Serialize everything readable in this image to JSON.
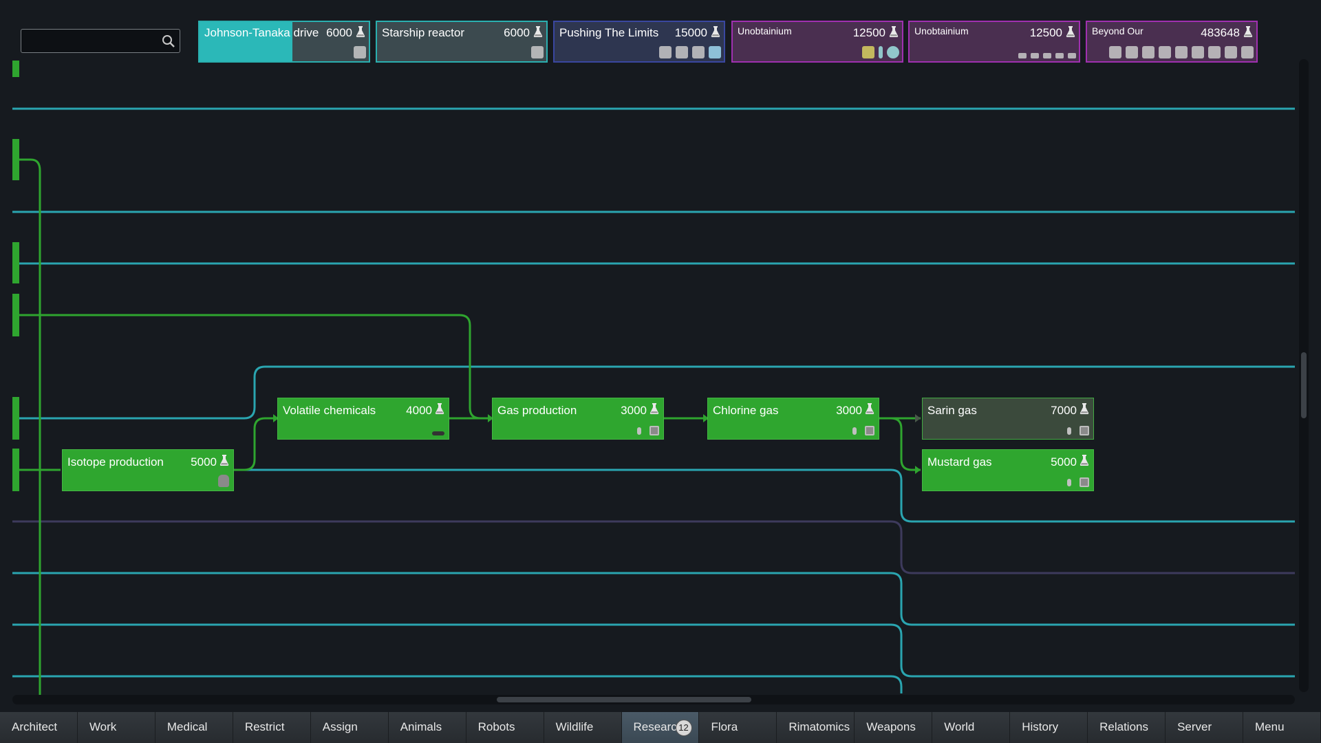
{
  "search": {
    "placeholder": "",
    "value": ""
  },
  "queue": [
    {
      "label": "Johnson-Tanaka drive",
      "cost": "6000",
      "progress": 0.55,
      "bg": "#3c4a4f",
      "fill": "#2bb8b8",
      "border": "#2ab0b0",
      "label_size": "normal",
      "unlocks": [
        "engine-icon"
      ]
    },
    {
      "label": "Starship reactor",
      "cost": "6000",
      "progress": 0,
      "bg": "#3c4a4f",
      "fill": "#2bb8b8",
      "border": "#2ab0b0",
      "label_size": "normal",
      "unlocks": [
        "reactor-icon"
      ]
    },
    {
      "label": "Pushing The Limits",
      "cost": "15000",
      "progress": 0,
      "bg": "#2e3650",
      "fill": "#3a4480",
      "border": "#3a47a0",
      "label_size": "normal",
      "unlocks": [
        "module-icon",
        "pillar-icon",
        "module-icon",
        "core-icon"
      ]
    },
    {
      "label": "Unobtainium",
      "cost": "12500",
      "progress": 0,
      "bg": "#4a2f50",
      "fill": "#7d3a86",
      "border": "#a030b0",
      "label_size": "small",
      "unlocks": [
        "hourglass-icon",
        "rod-icon",
        "orb-icon"
      ]
    },
    {
      "label": "Unobtainium",
      "cost": "12500",
      "progress": 0,
      "bg": "#4a2f50",
      "fill": "#7d3a86",
      "border": "#a030b0",
      "label_size": "small",
      "unlocks": [
        "rifle-icon",
        "rifle-icon",
        "pistol-icon",
        "ammo-icon",
        "ammo-icon"
      ]
    },
    {
      "label": "Beyond Our",
      "cost": "483648",
      "progress": 0,
      "bg": "#4a2f50",
      "fill": "#7d3a86",
      "border": "#a030b0",
      "label_size": "small",
      "unlocks": [
        "chain-icon",
        "plate-icon",
        "plate-icon",
        "chip-icon",
        "rock-icon",
        "box-icon",
        "tool-icon",
        "tool-icon",
        "panel-icon"
      ]
    }
  ],
  "projects": [
    {
      "id": "isotope",
      "label": "Isotope production",
      "cost": "5000",
      "state": "done",
      "unlocks": [
        "ore-icon"
      ]
    },
    {
      "id": "volatile",
      "label": "Volatile chemicals",
      "cost": "4000",
      "state": "done",
      "unlocks": [
        "tool-icon"
      ]
    },
    {
      "id": "gas",
      "label": "Gas production",
      "cost": "3000",
      "state": "done",
      "unlocks": [
        "flame-icon",
        "machine-icon"
      ]
    },
    {
      "id": "chlorine",
      "label": "Chlorine gas",
      "cost": "3000",
      "state": "done",
      "unlocks": [
        "flame-icon",
        "machine-icon"
      ]
    },
    {
      "id": "sarin",
      "label": "Sarin gas",
      "cost": "7000",
      "state": "available",
      "unlocks": [
        "flame-icon",
        "machine-icon"
      ]
    },
    {
      "id": "mustard",
      "label": "Mustard gas",
      "cost": "5000",
      "state": "done",
      "unlocks": [
        "flame-icon",
        "machine-icon"
      ]
    }
  ],
  "colors": {
    "done": "#2fa62f",
    "available": "#3b4a3c",
    "teal_line": "#2aa5b0",
    "green_line": "#2fa52f",
    "purple_line": "#3d3a5c"
  },
  "tabs": [
    {
      "label": "Architect",
      "active": false
    },
    {
      "label": "Work",
      "active": false
    },
    {
      "label": "Medical",
      "active": false
    },
    {
      "label": "Restrict",
      "active": false
    },
    {
      "label": "Assign",
      "active": false
    },
    {
      "label": "Animals",
      "active": false
    },
    {
      "label": "Robots",
      "active": false
    },
    {
      "label": "Wildlife",
      "active": false
    },
    {
      "label": "Research",
      "active": true,
      "badge": "12"
    },
    {
      "label": "Flora",
      "active": false
    },
    {
      "label": "Rimatomics",
      "active": false
    },
    {
      "label": "Weapons",
      "active": false
    },
    {
      "label": "World",
      "active": false
    },
    {
      "label": "History",
      "active": false
    },
    {
      "label": "Relations",
      "active": false
    },
    {
      "label": "Server",
      "active": false
    },
    {
      "label": "Menu",
      "active": false
    }
  ]
}
